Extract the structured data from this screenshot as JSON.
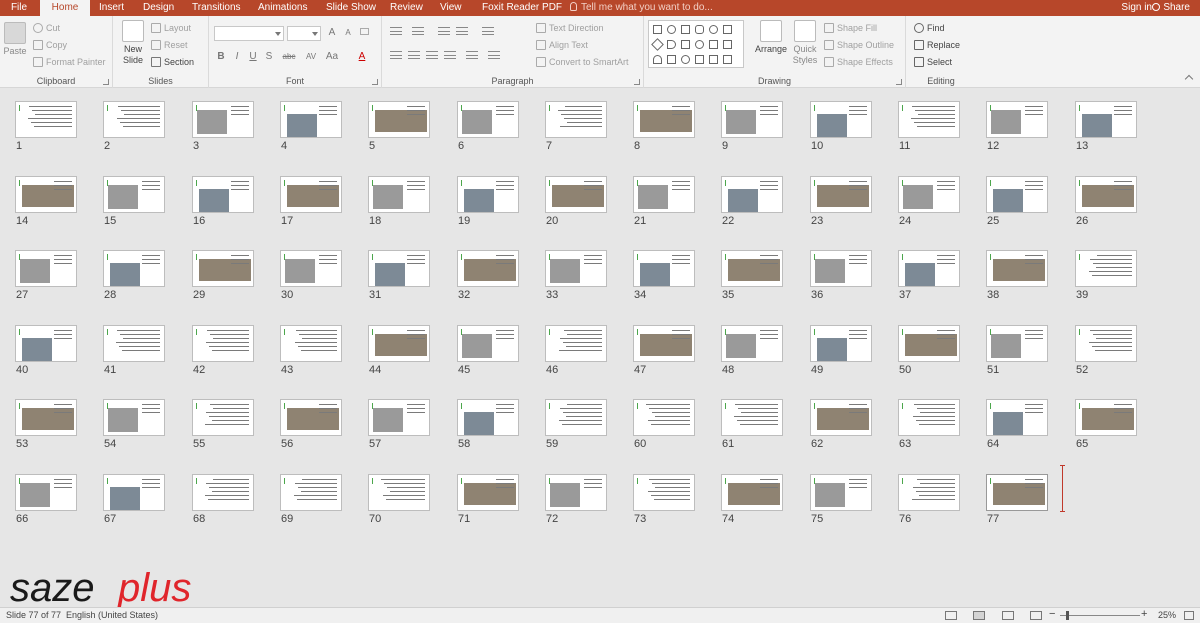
{
  "tabs": {
    "file": "File",
    "items": [
      {
        "label": "Home",
        "active": true
      },
      {
        "label": "Insert"
      },
      {
        "label": "Design"
      },
      {
        "label": "Transitions"
      },
      {
        "label": "Animations"
      },
      {
        "label": "Slide Show"
      },
      {
        "label": "Review"
      },
      {
        "label": "View"
      },
      {
        "label": "Foxit Reader PDF"
      }
    ],
    "tell_me": "Tell me what you want to do...",
    "sign_in": "Sign in",
    "share": "Share"
  },
  "ribbon": {
    "clipboard": {
      "paste": "Paste",
      "cut": "Cut",
      "copy": "Copy",
      "format_painter": "Format Painter",
      "label": "Clipboard"
    },
    "slides": {
      "new_slide_1": "New",
      "new_slide_2": "Slide",
      "layout": "Layout",
      "reset": "Reset",
      "section": "Section",
      "label": "Slides"
    },
    "font": {
      "font_name": "",
      "font_size": "",
      "bold": "B",
      "italic": "I",
      "underline": "U",
      "shadow": "S",
      "strike": "abc",
      "spacing": "AV",
      "case": "Aa",
      "grow": "A",
      "shrink": "A",
      "color": "A",
      "label": "Font"
    },
    "paragraph": {
      "text_direction": "Text Direction",
      "align_text": "Align Text",
      "convert_smartart": "Convert to SmartArt",
      "label": "Paragraph"
    },
    "drawing": {
      "arrange": "Arrange",
      "quick_styles_1": "Quick",
      "quick_styles_2": "Styles",
      "shape_fill": "Shape Fill",
      "shape_outline": "Shape Outline",
      "shape_effects": "Shape Effects",
      "label": "Drawing"
    },
    "editing": {
      "find": "Find",
      "replace": "Replace",
      "select": "Select",
      "label": "Editing"
    }
  },
  "slides": {
    "count": 77,
    "selected": 77,
    "numbers": [
      "1",
      "2",
      "3",
      "4",
      "5",
      "6",
      "7",
      "8",
      "9",
      "10",
      "11",
      "12",
      "13",
      "14",
      "15",
      "16",
      "17",
      "18",
      "19",
      "20",
      "21",
      "22",
      "23",
      "24",
      "25",
      "26",
      "27",
      "28",
      "29",
      "30",
      "31",
      "32",
      "33",
      "34",
      "35",
      "36",
      "37",
      "38",
      "39",
      "40",
      "41",
      "42",
      "43",
      "44",
      "45",
      "46",
      "47",
      "48",
      "49",
      "50",
      "51",
      "52",
      "53",
      "54",
      "55",
      "56",
      "57",
      "58",
      "59",
      "60",
      "61",
      "62",
      "63",
      "64",
      "65",
      "66",
      "67",
      "68",
      "69",
      "70",
      "71",
      "72",
      "73",
      "74",
      "75",
      "76",
      "77"
    ],
    "image_heavy": [
      3,
      4,
      5,
      6,
      8,
      9,
      10,
      12,
      13,
      14,
      15,
      16,
      17,
      18,
      19,
      20,
      21,
      22,
      23,
      24,
      25,
      26,
      27,
      28,
      29,
      30,
      31,
      32,
      33,
      34,
      35,
      36,
      37,
      38,
      40,
      44,
      45,
      47,
      48,
      49,
      50,
      51,
      53,
      54,
      56,
      57,
      58,
      62,
      64,
      65,
      66,
      67,
      71,
      72,
      74,
      75,
      77
    ]
  },
  "logo": {
    "text_black": "saze",
    "text_red": "plus",
    "black_color": "#1a1a1a",
    "red_color": "#e0252b"
  },
  "status": {
    "slide_info": "Slide 77 of 77",
    "language": "English (United States)",
    "zoom": "25%",
    "zoom_out": "−",
    "zoom_in": "+"
  },
  "colors": {
    "accent": "#b7472a",
    "ribbon": "#f3f3f3",
    "canvas": "#e6e6e6"
  }
}
